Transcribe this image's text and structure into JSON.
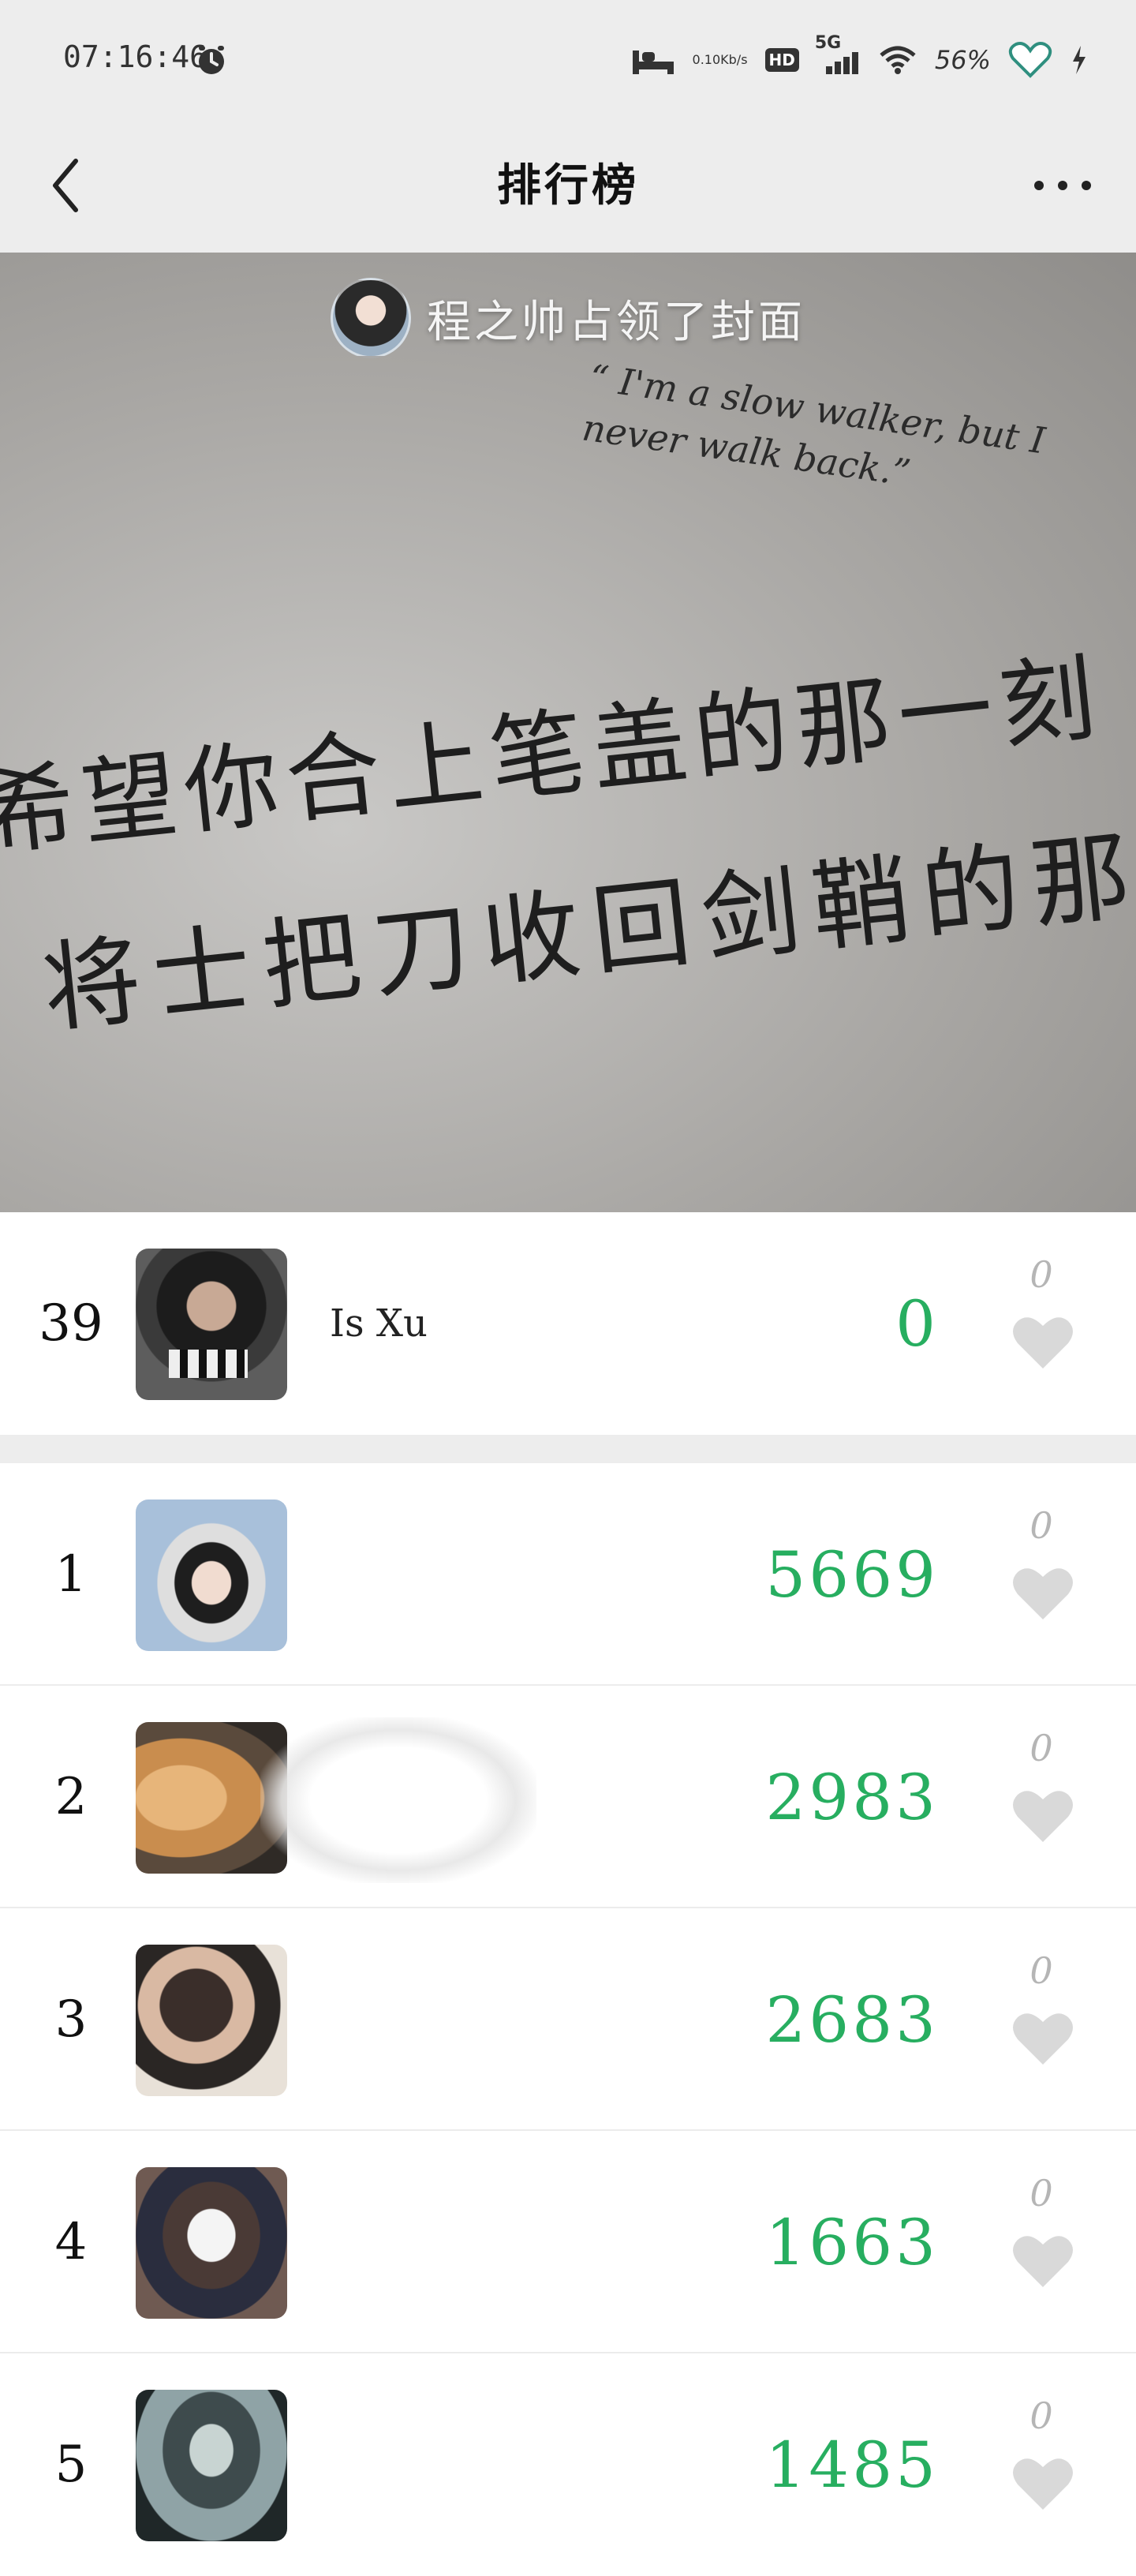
{
  "status_bar": {
    "time": "07:16:46",
    "net_speed_value": "0.10",
    "net_speed_unit": "Kb/s",
    "hd": "HD",
    "network": "5G",
    "battery": "56%"
  },
  "nav": {
    "title": "排行榜",
    "back_icon": "chevron-left-icon",
    "more_icon": "more-dots-icon"
  },
  "cover": {
    "banner_text": "程之帅占领了封面",
    "quote": "“ I'm a slow walker, but I never walk back.”",
    "handwriting_line1": "希望你合上笔盖的那一刻",
    "handwriting_line2": "将士把刀收回剑鞘的那"
  },
  "my_entry": {
    "rank": "39",
    "name": "Is Xu",
    "score": "0",
    "likes": "0"
  },
  "leaderboard": [
    {
      "rank": "1",
      "name": "",
      "score": "5669",
      "likes": "0"
    },
    {
      "rank": "2",
      "name": "",
      "score": "2983",
      "likes": "0"
    },
    {
      "rank": "3",
      "name": "",
      "score": "2683",
      "likes": "0"
    },
    {
      "rank": "4",
      "name": "",
      "score": "1663",
      "likes": "0"
    },
    {
      "rank": "5",
      "name": "",
      "score": "1485",
      "likes": "0"
    }
  ],
  "colors": {
    "score_green": "#27ae60",
    "like_gray": "#b5b5b5",
    "bar_bg": "#ededed"
  }
}
